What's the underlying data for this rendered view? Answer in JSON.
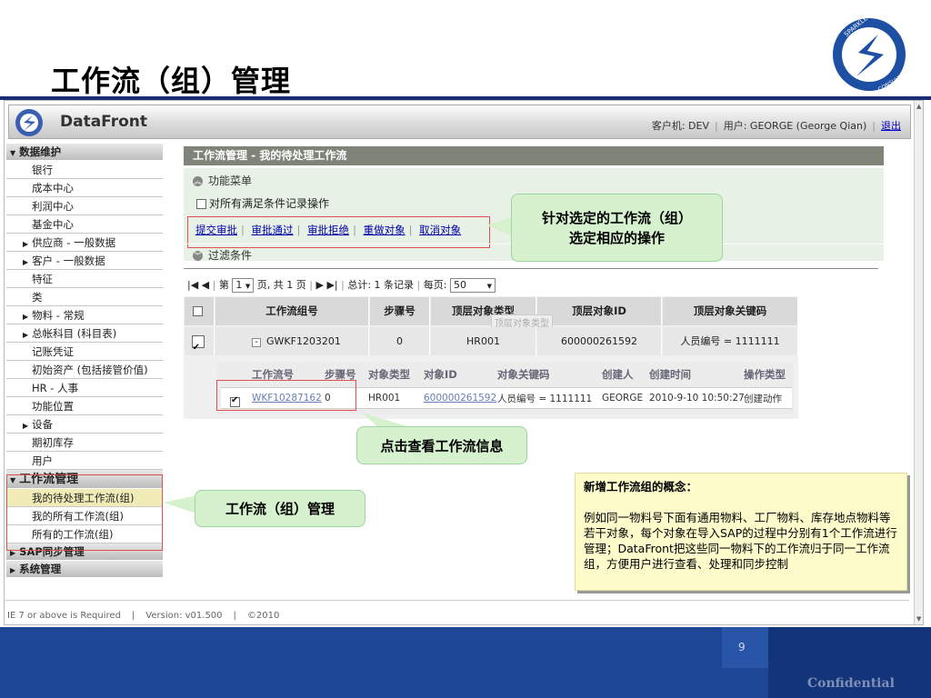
{
  "slide": {
    "title": "工作流（组）管理",
    "page_number": "9",
    "confidential": "Confidential"
  },
  "app": {
    "name": "DataFront",
    "client_label": "客户机: DEV",
    "user_label": "用户: GEORGE (George Qian)",
    "logout": "退出"
  },
  "sidebar": {
    "sections": [
      {
        "label": "数据维护"
      },
      {
        "label": "工作流管理"
      },
      {
        "label": "SAP同步管理"
      },
      {
        "label": "系统管理"
      }
    ],
    "data_items": [
      {
        "label": "银行"
      },
      {
        "label": "成本中心"
      },
      {
        "label": "利润中心"
      },
      {
        "label": "基金中心"
      },
      {
        "label": "供应商 - 一般数据"
      },
      {
        "label": "客户 - 一般数据"
      },
      {
        "label": "特征"
      },
      {
        "label": "类"
      },
      {
        "label": "物料 - 常规"
      },
      {
        "label": "总帐科目 (科目表)"
      },
      {
        "label": "记账凭证"
      },
      {
        "label": "初始资产 (包括接管价值)"
      },
      {
        "label": "HR - 人事"
      },
      {
        "label": "功能位置"
      },
      {
        "label": "设备"
      },
      {
        "label": "期初库存"
      },
      {
        "label": "用户"
      }
    ],
    "wf_items": [
      {
        "label": "我的待处理工作流(组)"
      },
      {
        "label": "我的所有工作流(组)"
      },
      {
        "label": "所有的工作流(组)"
      }
    ]
  },
  "main": {
    "header": "工作流管理 - 我的待处理工作流",
    "function_menu": "功能菜单",
    "all_records_checkbox": "对所有满足条件记录操作",
    "actions": [
      "提交审批",
      "审批通过",
      "审批拒绝",
      "重做对象",
      "取消对象"
    ],
    "filter": "过滤条件",
    "pager": {
      "page_prefix": "第",
      "page_value": "1",
      "page_suffix": "页, 共 1 页",
      "total": "总计: 1 条记录",
      "per_page_label": "每页:",
      "per_page_value": "50"
    },
    "grid": {
      "headers": [
        "工作流组号",
        "步骤号",
        "顶层对象类型",
        "顶层对象ID",
        "顶层对象关键码"
      ],
      "tooltip": "顶层对象类型",
      "row": {
        "group_no": "GWKF1203201",
        "step": "0",
        "type": "HR001",
        "id": "600000261592",
        "key": "人员编号 = 1111111"
      },
      "sub_headers": [
        "工作流号",
        "步骤号",
        "对象类型",
        "对象ID",
        "对象关键码",
        "创建人",
        "创建时间",
        "操作类型"
      ],
      "sub_row": {
        "wf_no": "WKF10287162",
        "step": "0",
        "type": "HR001",
        "id": "600000261592",
        "key": "人员编号 = 1111111",
        "creator": "GEORGE",
        "created": "2010-9-10 10:50:27",
        "op": "创建动作"
      }
    }
  },
  "callouts": {
    "actions_line1": "针对选定的工作流（组）",
    "actions_line2": "选定相应的操作",
    "row": "点击查看工作流信息",
    "sidebar": "工作流（组）管理"
  },
  "note": {
    "title": "新增工作流组的概念：",
    "body": "例如同一物料号下面有通用物料、工厂物料、库存地点物料等若干对象，每个对象在导入SAP的过程中分别有1个工作流进行管理；DataFront把这些同一物料下的工作流归于同一工作流组，方便用户进行查看、处理和同步控制"
  },
  "footer": {
    "req": "IE 7 or above is Required",
    "version": "Version: v01.500",
    "copyright": "©2010"
  },
  "colors": {
    "brand_blue": "#1d4696",
    "header_gray": "#7f8478",
    "callout_green": "#d6f1cd",
    "note_yellow": "#fefccb",
    "highlight_red": "#e05050"
  }
}
